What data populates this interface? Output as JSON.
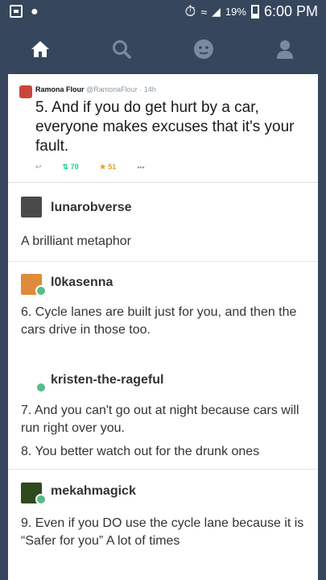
{
  "status_bar": {
    "battery": "19%",
    "time": "6:00 PM"
  },
  "nav": {
    "icons": [
      "home-icon",
      "search-icon",
      "activity-icon",
      "account-icon"
    ]
  },
  "tweet": {
    "name": "Ramona Flour",
    "handle": "@RamonaFlour · 14h",
    "text": "5. And if you do get hurt by a car, everyone makes excuses that it's your fault.",
    "retweets": "70",
    "likes": "51",
    "more": "•••"
  },
  "posts": [
    {
      "user": "lunarobverse",
      "text": "A brilliant metaphor"
    },
    {
      "user": "l0kasenna",
      "text": "6. Cycle lanes are built just for you, and then the cars drive in those too."
    },
    {
      "user": "kristen-the-rageful",
      "text": "7. And you can't go out at night because cars will run right over you.",
      "text2": "8. You better watch out for the drunk ones"
    },
    {
      "user": "mekahmagick",
      "text": "9. Even if you DO use the cycle lane because it is “Safer for you” A lot of times"
    }
  ],
  "colors": {
    "navbar": "#36465d",
    "reblog": "#56bc8a",
    "retweet": "#19cf86",
    "favorite": "#e5a128"
  }
}
